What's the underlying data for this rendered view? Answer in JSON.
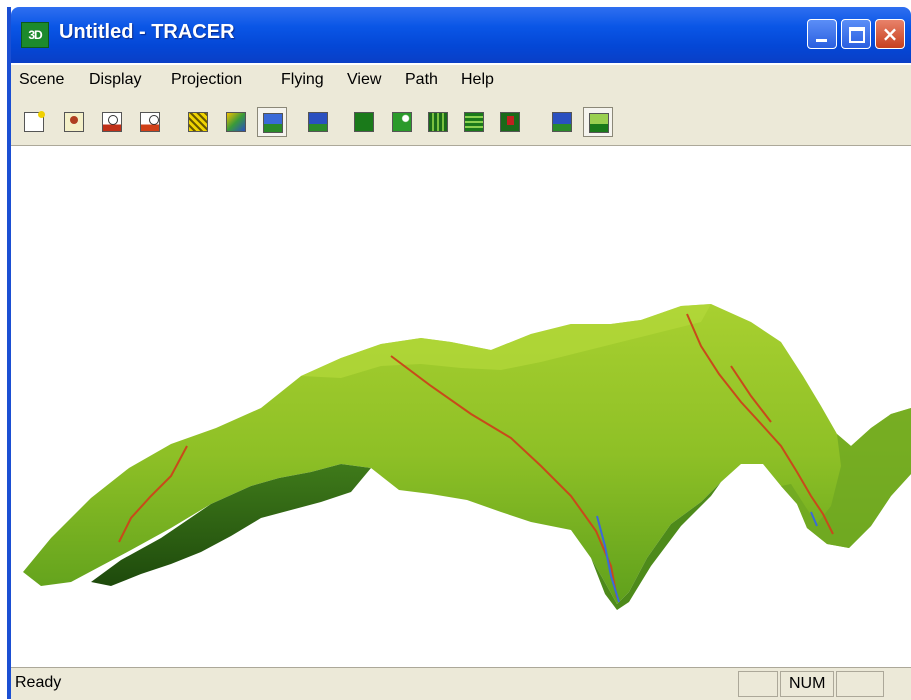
{
  "window": {
    "app_icon_text": "3D",
    "title": "Untitled - TRACER",
    "close_glyph": "×"
  },
  "menu": [
    "Scene",
    "Display",
    "Projection",
    "Flying",
    "View",
    "Path",
    "Help"
  ],
  "toolbar": {
    "buttons": [
      {
        "icon": "new-document-icon"
      },
      {
        "icon": "open-scene-icon"
      },
      {
        "icon": "terrain-person-icon"
      },
      {
        "icon": "terrain-person-alt-icon"
      },
      {
        "icon": "texture-yellow-icon"
      },
      {
        "icon": "texture-map-icon"
      },
      {
        "icon": "landscape-view-icon",
        "pressed": true
      },
      {
        "icon": "flag-path-icon"
      },
      {
        "icon": "green-square-icon"
      },
      {
        "icon": "green-curve-icon"
      },
      {
        "icon": "terrain-grid-icon"
      },
      {
        "icon": "terrain-grid-alt-icon"
      },
      {
        "icon": "marker-icon"
      },
      {
        "icon": "mountain-blue-icon"
      },
      {
        "icon": "mountain-green-icon",
        "pressed": true
      }
    ]
  },
  "colors": {
    "titlebar": "#0a56e6",
    "terrain_light": "#9ccc2a",
    "terrain_dark": "#2f6a14",
    "river": "#c84a1a",
    "water": "#3b6ad8"
  },
  "status": {
    "text": "Ready",
    "num": "NUM"
  }
}
